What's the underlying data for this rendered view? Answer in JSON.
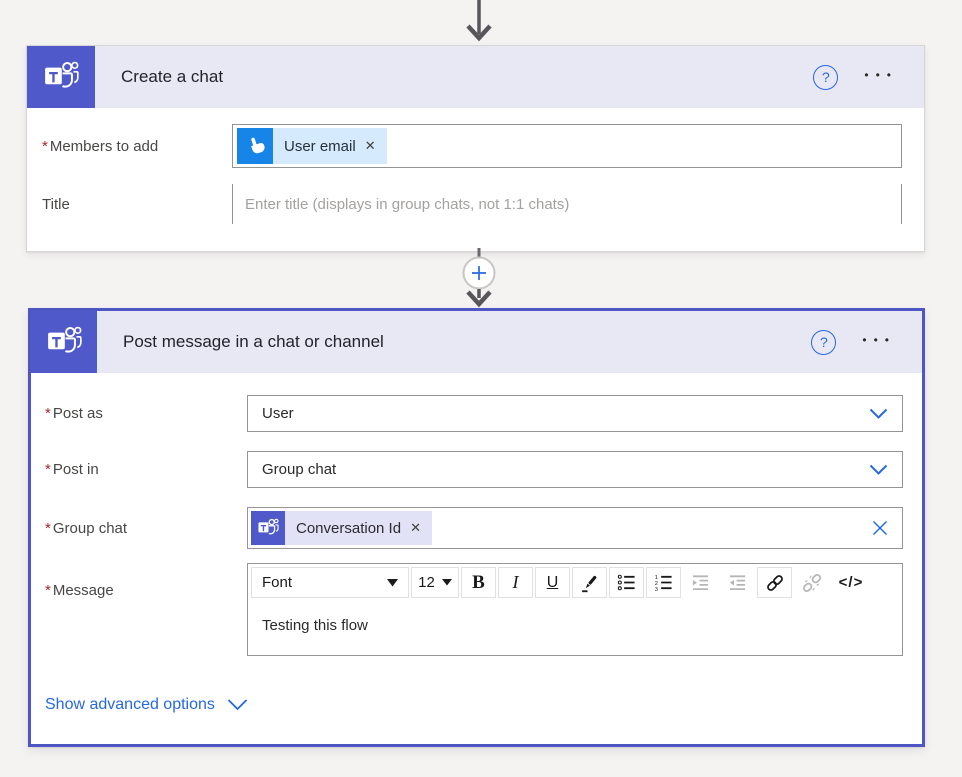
{
  "icons": {
    "help": "?",
    "more": "•••",
    "remove": "✕",
    "required": "*"
  },
  "card1": {
    "title": "Create a chat",
    "members": {
      "label": "Members to add",
      "token": "User email"
    },
    "title_field": {
      "label": "Title",
      "placeholder": "Enter title (displays in group chats, not 1:1 chats)"
    }
  },
  "card2": {
    "title": "Post message in a chat or channel",
    "post_as": {
      "label": "Post as",
      "value": "User"
    },
    "post_in": {
      "label": "Post in",
      "value": "Group chat"
    },
    "group_chat": {
      "label": "Group chat",
      "token": "Conversation Id"
    },
    "message": {
      "label": "Message",
      "text": "Testing this flow"
    },
    "toolbar": {
      "font": "Font",
      "size": "12",
      "bold": "B",
      "italic": "I",
      "underline": "U",
      "code": "</>"
    },
    "advanced_link": "Show advanced options"
  },
  "colors": {
    "teams_purple": "#5059c9",
    "selected_border": "#4e56c4",
    "header_bg": "#e8e8f5",
    "accent_blue": "#2568e4",
    "token_blue_icon": "#1784e8",
    "token_blue_bg": "#d5eafc",
    "token_purple_bg": "#e2e2f6",
    "page_bg": "#f4f3f2",
    "required_red": "#a4262c"
  }
}
